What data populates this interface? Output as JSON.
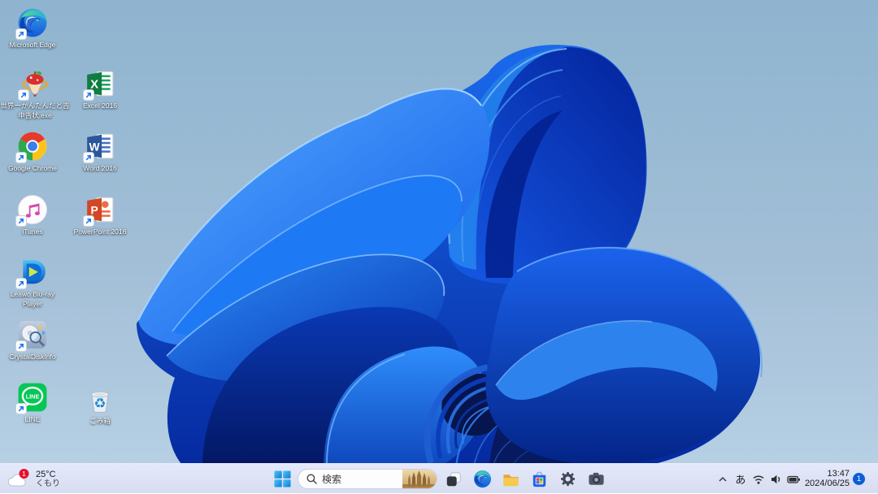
{
  "wallpaper": {
    "name": "Windows 11 Bloom",
    "background_top": "#8fb4cf",
    "background_bottom": "#b9d2e6",
    "bloom_bright": "#2e8ffe",
    "bloom_dark": "#04207c"
  },
  "desktop": {
    "icons": [
      {
        "id": "edge",
        "label": "Microsoft Edge"
      },
      {
        "id": "shinkoku",
        "label": "世界一かんたんだと吉\n申告状.exe"
      },
      {
        "id": "chrome",
        "label": "Google Chrome"
      },
      {
        "id": "itunes",
        "label": "iTunes"
      },
      {
        "id": "leawo",
        "label": "Leawo Blu-ray\nPlayer"
      },
      {
        "id": "crystaldiskinfo",
        "label": "CrystalDiskInfo"
      },
      {
        "id": "line",
        "label": "LINE",
        "icon_text": "LINE"
      },
      {
        "id": "excel",
        "label": "Excel 2016",
        "icon_letter": "X"
      },
      {
        "id": "word",
        "label": "Word 2016",
        "icon_letter": "W"
      },
      {
        "id": "powerpoint",
        "label": "PowerPoint 2016",
        "icon_letter": "P"
      },
      {
        "id": "recycle-bin",
        "label": "ごみ箱"
      }
    ]
  },
  "taskbar": {
    "weather": {
      "temperature": "25°C",
      "condition": "くもり",
      "badge": "1"
    },
    "search": {
      "placeholder": "検索"
    },
    "tray": {
      "ime": "あ",
      "time": "13:47",
      "date": "2024/06/25",
      "notification_count": "1"
    }
  }
}
